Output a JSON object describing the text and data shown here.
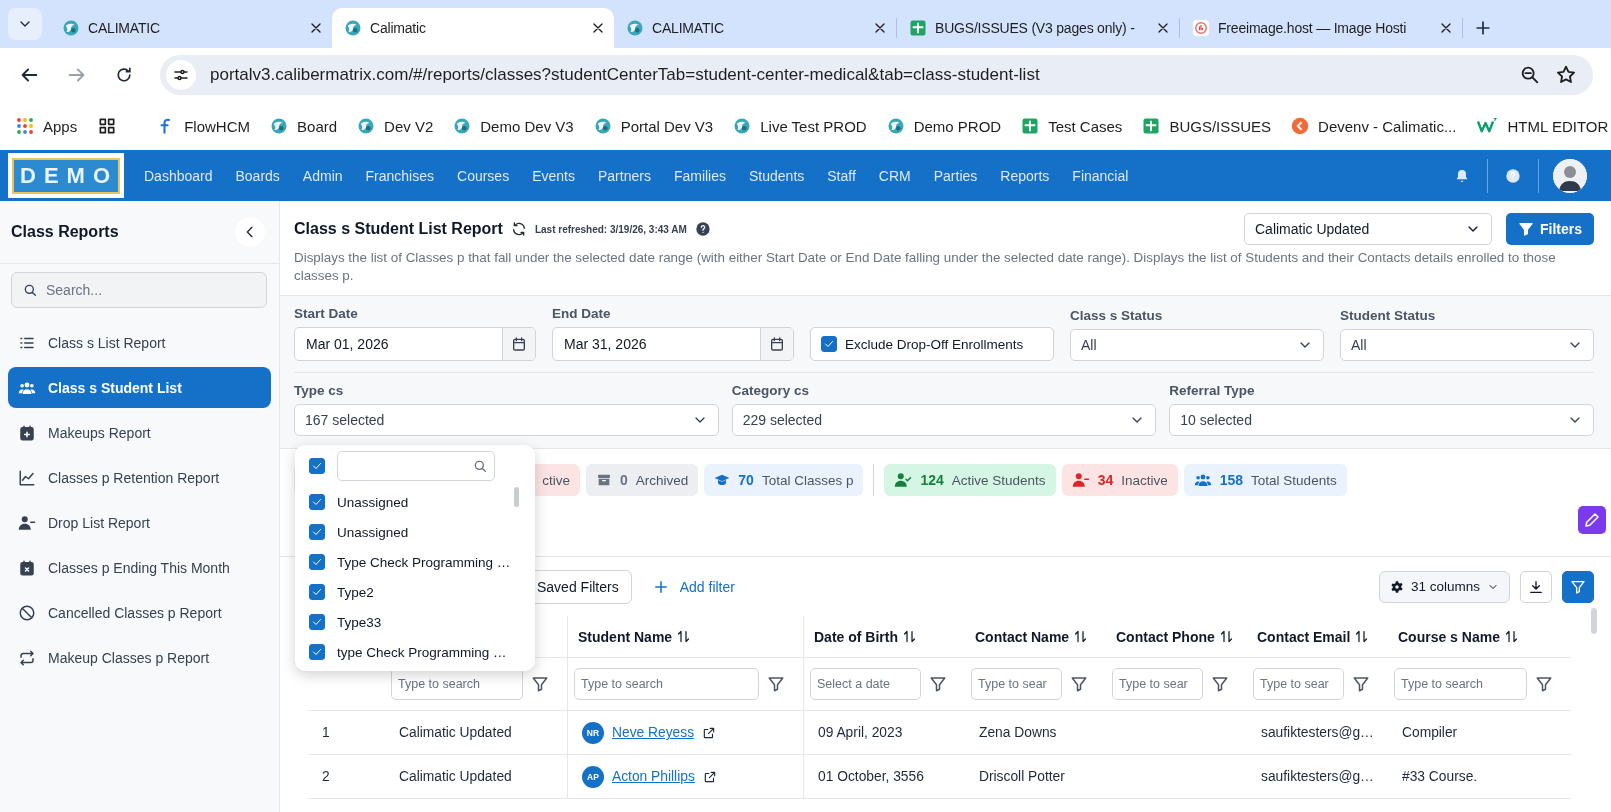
{
  "browser": {
    "tabs": [
      {
        "title": "CALIMATIC",
        "selected": false
      },
      {
        "title": "Calimatic",
        "selected": true
      },
      {
        "title": "CALIMATIC",
        "selected": false
      },
      {
        "title": "BUGS/ISSUES (V3 pages only) -",
        "selected": false
      },
      {
        "title": "Freeimage.host — Image Hosti",
        "selected": false
      }
    ],
    "url": "portalv3.calibermatrix.com/#/reports/classes?studentCenterTab=student-center-medical&tab=class-student-list",
    "apps_label": "Apps",
    "bookmarks": [
      "FlowHCM",
      "Board",
      "Dev V2",
      "Demo Dev V3",
      "Portal Dev V3",
      "Live Test PROD",
      "Demo PROD",
      "Test Cases",
      "BUGS/ISSUES",
      "Devenv - Calimatic...",
      "HTML EDITOR"
    ]
  },
  "app": {
    "logo": "DEMO",
    "nav": [
      "Dashboard",
      "Boards",
      "Admin",
      "Franchises",
      "Courses",
      "Events",
      "Partners",
      "Families",
      "Students",
      "Staff",
      "CRM",
      "Parties",
      "Reports",
      "Financial"
    ]
  },
  "sidebar": {
    "title": "Class Reports",
    "search_placeholder": "Search...",
    "items": [
      {
        "label": "Class s List Report",
        "selected": false
      },
      {
        "label": "Class s Student List",
        "selected": true
      },
      {
        "label": "Makeups Report",
        "selected": false
      },
      {
        "label": "Classes p Retention Report",
        "selected": false
      },
      {
        "label": "Drop List Report",
        "selected": false
      },
      {
        "label": "Classes p Ending This Month",
        "selected": false
      },
      {
        "label": "Cancelled Classes p Report",
        "selected": false
      },
      {
        "label": "Makeup Classes p Report",
        "selected": false
      }
    ]
  },
  "report": {
    "title": "Class s Student List Report",
    "last_refreshed": "Last refreshed: 3/19/26, 3:43 AM",
    "company": "Calimatic Updated",
    "filters_button": "Filters",
    "description": "Displays the list of Classes p that fall under the selected date range (with either Start Date or End Date falling under the selected date range). Displays the list of Students and their Contacts details enrolled to those classes p."
  },
  "filters": {
    "start_date": {
      "label": "Start Date",
      "value": "Mar 01, 2026"
    },
    "end_date": {
      "label": "End Date",
      "value": "Mar 31, 2026"
    },
    "exclude_dropoff": {
      "label": "Exclude Drop-Off Enrollments",
      "checked": true
    },
    "class_status": {
      "label": "Class s Status",
      "value": "All"
    },
    "student_status": {
      "label": "Student Status",
      "value": "All"
    },
    "type": {
      "label": "Type cs",
      "value": "167 selected"
    },
    "category": {
      "label": "Category cs",
      "value": "229 selected"
    },
    "referral": {
      "label": "Referral Type",
      "value": "10 selected"
    }
  },
  "type_dropdown": {
    "select_all_checked": true,
    "options": [
      {
        "label": "Unassigned",
        "checked": true
      },
      {
        "label": "Unassigned",
        "checked": true
      },
      {
        "label": "Type Check Programming …",
        "checked": true
      },
      {
        "label": "Type2",
        "checked": true
      },
      {
        "label": "Type33",
        "checked": true
      },
      {
        "label": "type Check Programming …",
        "checked": true
      }
    ]
  },
  "class_stats": [
    {
      "label": "ctive",
      "kind": "danger"
    },
    {
      "count": "0",
      "label": "Archived",
      "kind": "neutral"
    },
    {
      "count": "70",
      "label": "Total Classes p",
      "kind": "info"
    }
  ],
  "student_stats": [
    {
      "count": "124",
      "label": "Active Students",
      "kind": "success"
    },
    {
      "count": "34",
      "label": "Inactive",
      "kind": "danger"
    },
    {
      "count": "158",
      "label": "Total Students",
      "kind": "info"
    }
  ],
  "toolbar": {
    "saved_filters": "Saved Filters",
    "add_filter": "Add filter",
    "columns": "31 columns"
  },
  "table": {
    "columns": [
      {
        "kind": "index"
      },
      {
        "kind": "text",
        "placeholder": "Type to search"
      },
      {
        "kind": "text",
        "label": "Student Name",
        "placeholder": "Type to search"
      },
      {
        "kind": "date",
        "label": "Date of Birth",
        "placeholder": "Select a date"
      },
      {
        "kind": "text",
        "label": "Contact Name",
        "placeholder": "Type to sear"
      },
      {
        "kind": "text",
        "label": "Contact Phone",
        "placeholder": "Type to sear"
      },
      {
        "kind": "text",
        "label": "Contact Email",
        "placeholder": "Type to sear"
      },
      {
        "kind": "text",
        "label": "Course s Name",
        "placeholder": "Type to search"
      }
    ],
    "rows": [
      {
        "index": "1",
        "class": "Calimatic Updated",
        "initials": "NR",
        "student": "Neve Reyess",
        "dob": "09 April, 2023",
        "contact": "Zena Downs",
        "email": "saufiktesters@g…",
        "course": "Compiler"
      },
      {
        "index": "2",
        "class": "Calimatic Updated",
        "initials": "AP",
        "student": "Acton Phillips",
        "dob": "01 October, 3556",
        "contact": "Driscoll Potter",
        "email": "saufiktesters@g…",
        "course": "#33 Course."
      }
    ]
  }
}
